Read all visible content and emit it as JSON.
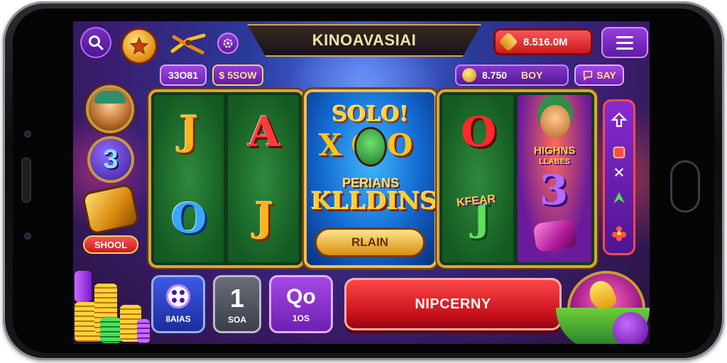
{
  "header": {
    "title": "KINOAVASIAI",
    "balance": "8.516.0M"
  },
  "subbar": {
    "pill_a": "33O81",
    "pill_b": "$ 5SOW",
    "credit_value": "8.750",
    "credit_unit": "BOY",
    "pay_label": "SAY"
  },
  "left": {
    "number_badge": "3",
    "school_label": "SHOOL"
  },
  "reels": {
    "left": [
      {
        "symbol": "J",
        "row": 0,
        "col": 0
      },
      {
        "symbol": "A",
        "row": 0,
        "col": 1
      },
      {
        "symbol": "O",
        "row": 1,
        "col": 0
      },
      {
        "symbol": "J",
        "row": 1,
        "col": 1
      }
    ],
    "right": [
      {
        "symbol": "O",
        "row": 0
      },
      {
        "symbol": "J",
        "row": 1
      }
    ]
  },
  "center_card": {
    "solo": "SOLO!",
    "xo": "XOO",
    "perians": "PERIANS",
    "klldins": "KLLDINS",
    "rlain": "RLAIN"
  },
  "character_card": {
    "title": "HIGHNS",
    "subtitle": "LLABES",
    "side_text": "KFEAR",
    "number": "3"
  },
  "bottom": {
    "dice_label": "8AIAS",
    "one_value": "1",
    "one_label": "SOA",
    "q_value": "Qo",
    "q_label": "1OS",
    "spin_label": "NIPCERNY"
  },
  "colors": {
    "accent_purple": "#7a2fc0",
    "accent_red": "#c8101a",
    "gold": "#d8a53c",
    "reel_green": "#145a22"
  },
  "icons": {
    "search": "search-icon",
    "star": "star-icon",
    "tools": "tools-icon",
    "settings": "settings-icon",
    "menu": "menu-icon",
    "coin": "coin-icon"
  }
}
